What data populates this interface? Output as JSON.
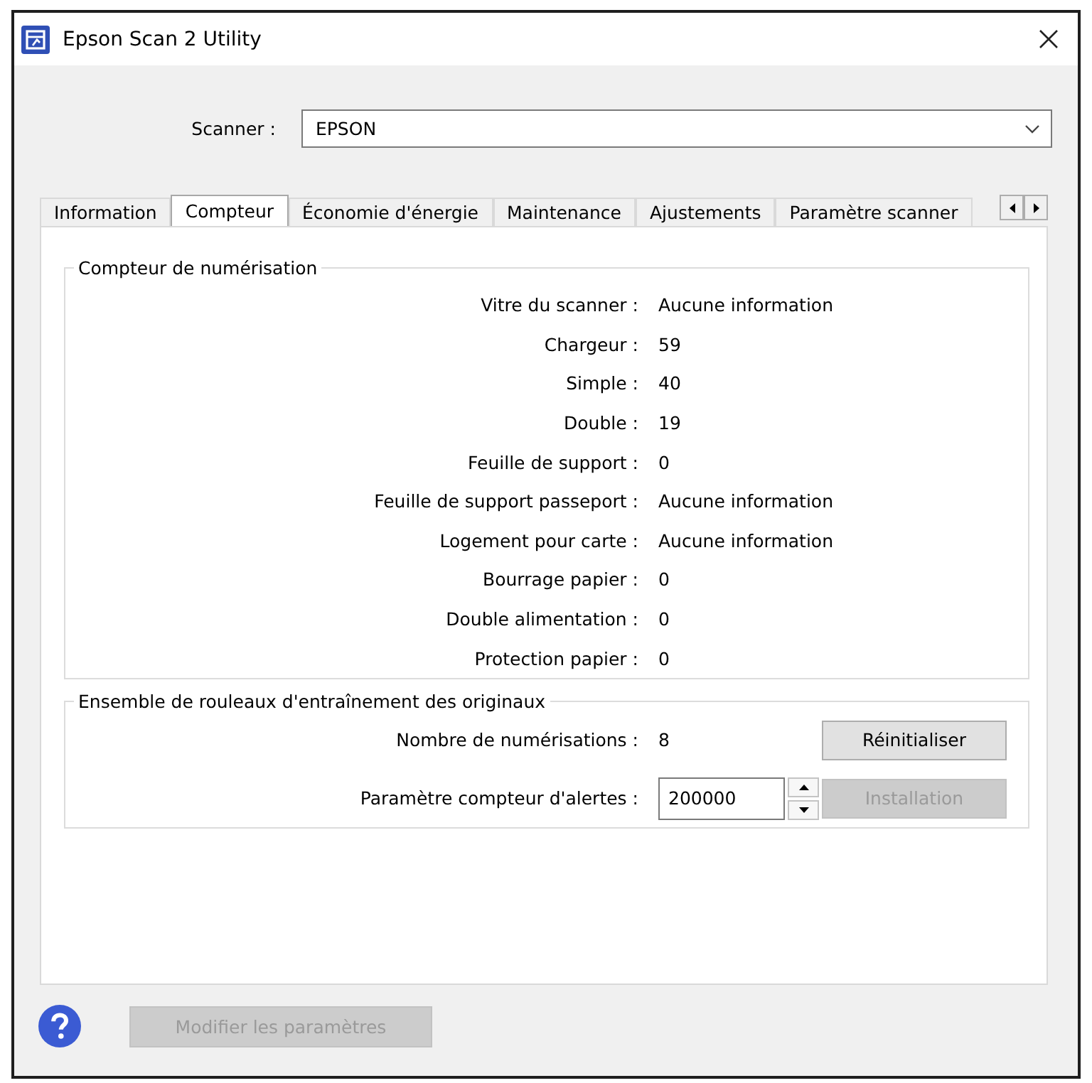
{
  "window": {
    "title": "Epson Scan 2 Utility"
  },
  "scanner": {
    "label": "Scanner :",
    "value": "EPSON"
  },
  "tabs": [
    {
      "label": "Information",
      "selected": false
    },
    {
      "label": "Compteur",
      "selected": true
    },
    {
      "label": "Économie d'énergie",
      "selected": false
    },
    {
      "label": "Maintenance",
      "selected": false
    },
    {
      "label": "Ajustements",
      "selected": false
    },
    {
      "label": "Paramètre scanner",
      "selected": false
    }
  ],
  "counter_group": {
    "title": "Compteur de numérisation",
    "rows": [
      {
        "label": "Vitre du scanner :",
        "value": "Aucune information"
      },
      {
        "label": "Chargeur :",
        "value": "59"
      },
      {
        "label": "Simple :",
        "value": "40"
      },
      {
        "label": "Double :",
        "value": "19"
      },
      {
        "label": "Feuille de support :",
        "value": "0"
      },
      {
        "label": "Feuille de support passeport :",
        "value": "Aucune information"
      },
      {
        "label": "Logement pour carte :",
        "value": "Aucune information"
      },
      {
        "label": "Bourrage papier :",
        "value": "0"
      },
      {
        "label": "Double alimentation :",
        "value": "0"
      },
      {
        "label": "Protection papier :",
        "value": "0"
      }
    ]
  },
  "roller_group": {
    "title": "Ensemble de rouleaux d'entraînement des originaux",
    "scan_count": {
      "label": "Nombre de numérisations :",
      "value": "8"
    },
    "reset_button": {
      "label": "Réinitialiser",
      "disabled": false
    },
    "alert_setting": {
      "label": "Paramètre compteur d'alertes :",
      "value": "200000"
    },
    "install_button": {
      "label": "Installation",
      "disabled": true
    }
  },
  "footer": {
    "modify_button": {
      "label": "Modifier les paramètres",
      "disabled": true
    }
  }
}
